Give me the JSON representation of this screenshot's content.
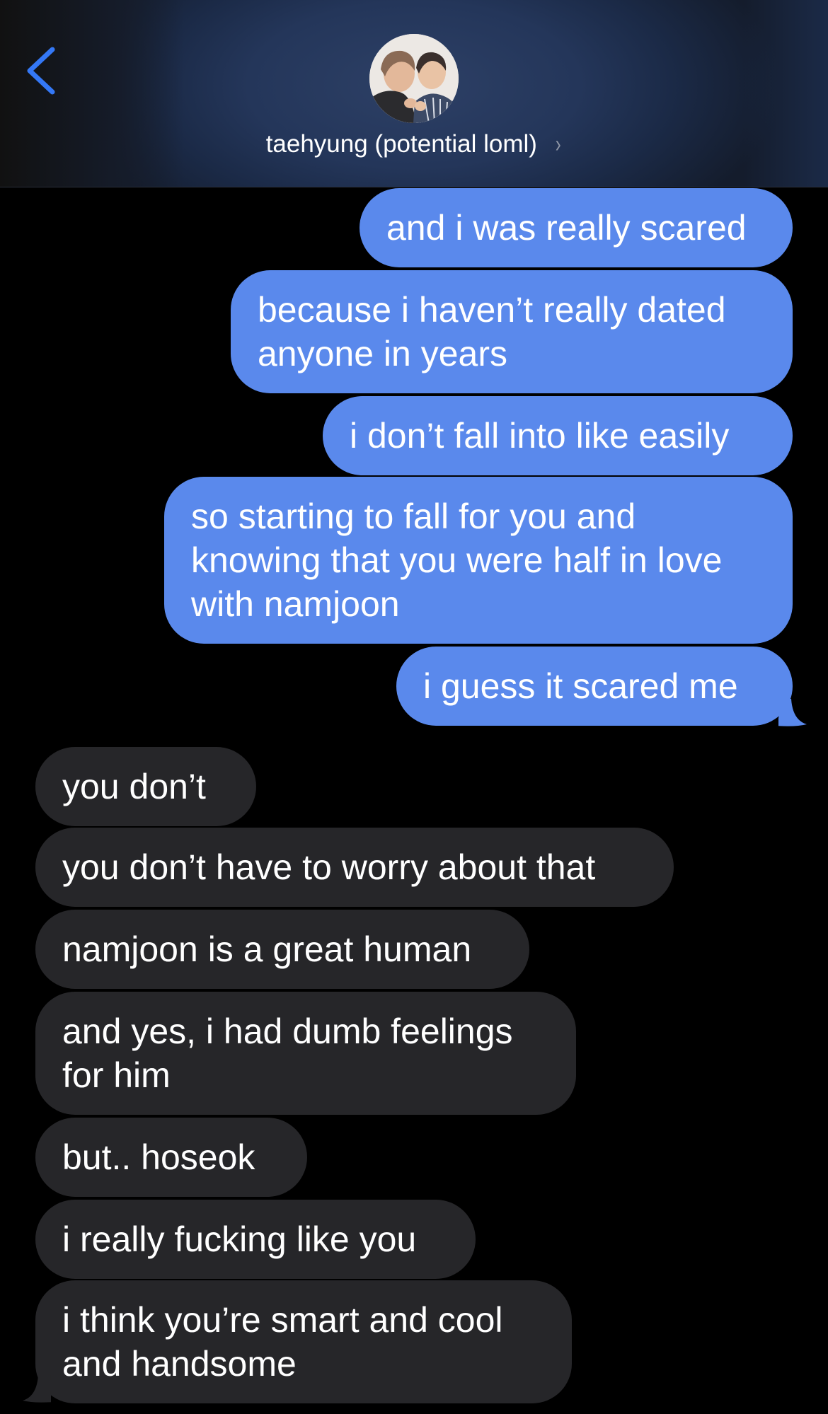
{
  "header": {
    "contact_name": "taehyung (potential loml)",
    "chevron": "›",
    "back_icon": "chevron-left-icon",
    "avatar": "contact-avatar-photo"
  },
  "colors": {
    "sent_bubble": "#5a89ec",
    "received_bubble": "#262629",
    "back_accent": "#3478f6",
    "background": "#000000"
  },
  "messages": {
    "sent": [
      {
        "text": "and i was really scared"
      },
      {
        "text": "because i haven’t really dated anyone in years"
      },
      {
        "text": "i don’t fall into like easily"
      },
      {
        "text": "so starting to fall for you and knowing that you were half in love with namjoon"
      },
      {
        "text": "i guess it scared me"
      }
    ],
    "received": [
      {
        "text": "you don’t"
      },
      {
        "text": "you don’t have to worry about that"
      },
      {
        "text": "namjoon is a great human"
      },
      {
        "text": "and yes, i had dumb feelings for him"
      },
      {
        "text": "but.. hoseok"
      },
      {
        "text": "i really fucking like you"
      },
      {
        "text": "i think you’re smart and cool and handsome"
      }
    ]
  }
}
